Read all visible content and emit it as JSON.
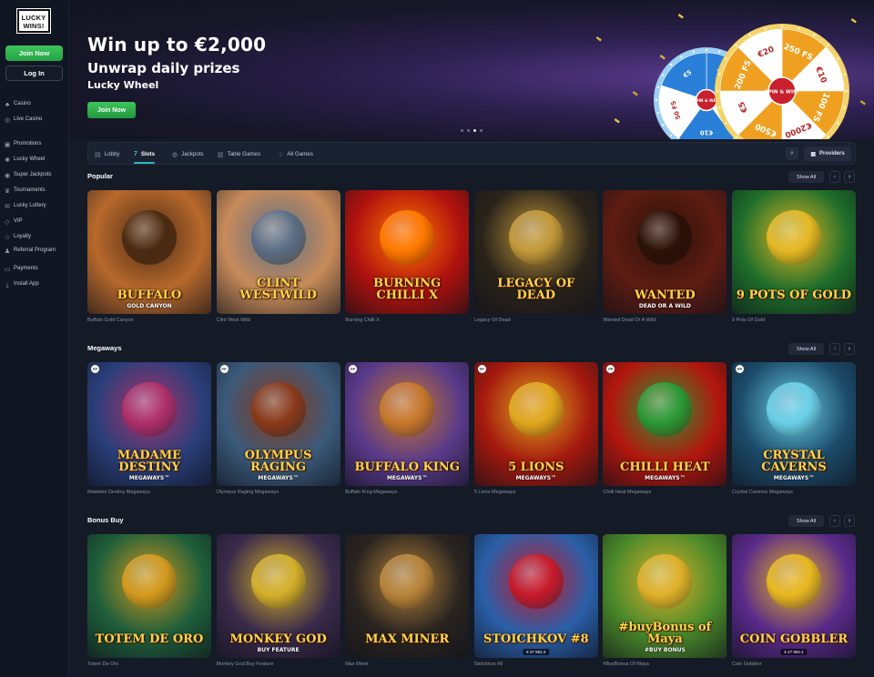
{
  "brand": {
    "logo_text": "LUCKY WINS!"
  },
  "sidebar": {
    "join_label": "Join Now",
    "login_label": "Log In",
    "items": [
      {
        "label": "Casino",
        "icon": "cards-icon"
      },
      {
        "label": "Live Casino",
        "icon": "live-icon"
      },
      {
        "label": "Promotions",
        "icon": "gift-icon"
      },
      {
        "label": "Lucky Wheel",
        "icon": "wheel-icon"
      },
      {
        "label": "Super Jackpots",
        "icon": "jackpot-icon"
      },
      {
        "label": "Tournaments",
        "icon": "trophy-icon"
      },
      {
        "label": "Lucky Lottery",
        "icon": "ticket-icon"
      },
      {
        "label": "VIP",
        "icon": "diamond-icon"
      },
      {
        "label": "Loyalty",
        "icon": "loyalty-icon"
      },
      {
        "label": "Referral Program",
        "icon": "referral-icon"
      },
      {
        "label": "Payments",
        "icon": "card-icon"
      },
      {
        "label": "Install App",
        "icon": "download-icon"
      }
    ]
  },
  "hero": {
    "title": "Win up to €2,000",
    "subtitle": "Unwrap daily prizes",
    "tagline": "Lucky Wheel",
    "cta": "Join Now",
    "wheel_big": {
      "labels": [
        "250 FS",
        "€10",
        "100 FS",
        "€2000",
        "€500",
        "€5",
        "200 FS",
        "€20"
      ],
      "center": "SPIN & WIN!"
    },
    "wheel_small": {
      "labels": [
        "25 FS",
        "€1000",
        "€10",
        "50 FS",
        "€5"
      ],
      "center": "SPIN & WIN!"
    },
    "slide_count": 4,
    "active_slide": 2
  },
  "tabs": [
    {
      "label": "Lobby",
      "icon": "lobby-icon",
      "active": false
    },
    {
      "label": "Slots",
      "icon": "slots-icon",
      "active": true
    },
    {
      "label": "Jackpots",
      "icon": "jackpot-icon",
      "active": false
    },
    {
      "label": "Table Games",
      "icon": "table-icon",
      "active": false
    },
    {
      "label": "All Games",
      "icon": "all-games-icon",
      "active": false
    }
  ],
  "providers_label": "Providers",
  "show_all_label": "Show All",
  "sections": [
    {
      "title": "Popular",
      "games": [
        {
          "name": "Buffalo Gold Canyon",
          "art_title": "BUFFALO",
          "art_sub": "GOLD CANYON",
          "bg": "#b8692c",
          "accent": "#4b2a12"
        },
        {
          "name": "Clint West Wild",
          "art_title": "CLINT WESTWILD",
          "art_sub": "",
          "bg": "#c88b5a",
          "accent": "#5b6e86"
        },
        {
          "name": "Burning Chilli X",
          "art_title": "BURNING CHILLI X",
          "art_sub": "",
          "bg": "#b0120e",
          "accent": "#ff7a00"
        },
        {
          "name": "Legacy Of Dead",
          "art_title": "LEGACY OF DEAD",
          "art_sub": "",
          "bg": "#2a231a",
          "accent": "#c49a3a"
        },
        {
          "name": "Wanted Dead Or A Wild",
          "art_title": "WANTED",
          "art_sub": "DEAD OR A WILD",
          "bg": "#5e1c12",
          "accent": "#2a1208"
        },
        {
          "name": "9 Pots Of Gold",
          "art_title": "9 POTS OF GOLD",
          "art_sub": "",
          "bg": "#1f6e2a",
          "accent": "#e6b823"
        }
      ]
    },
    {
      "title": "Megaways",
      "games": [
        {
          "name": "Madame Destiny Megaways",
          "art_title": "MADAME DESTINY",
          "art_sub": "MEGAWAYS™",
          "bg": "#2a3f7a",
          "accent": "#b0306a"
        },
        {
          "name": "Olympus Raging Megaways",
          "art_title": "OLYMPUS RAGING",
          "art_sub": "MEGAWAYS™",
          "bg": "#3b5a7a",
          "accent": "#8b3a1a"
        },
        {
          "name": "Buffalo King Megaways",
          "art_title": "BUFFALO KING",
          "art_sub": "MEGAWAYS™",
          "bg": "#5a3a8a",
          "accent": "#c8782a"
        },
        {
          "name": "5 Lions Megaways",
          "art_title": "5 LIONS",
          "art_sub": "MEGAWAYS™",
          "bg": "#a5190e",
          "accent": "#e0a91e"
        },
        {
          "name": "Chilli Heat Megaways",
          "art_title": "CHILLI HEAT",
          "art_sub": "MEGAWAYS™",
          "bg": "#b3160e",
          "accent": "#2a9a36"
        },
        {
          "name": "Crystal Caverns Megaways",
          "art_title": "CRYSTAL CAVERNS",
          "art_sub": "MEGAWAYS™",
          "bg": "#1c4b6a",
          "accent": "#6ad0e8"
        }
      ]
    },
    {
      "title": "Bonus Buy",
      "games": [
        {
          "name": "Totem De Oro",
          "art_title": "TOTEM DE ORO",
          "art_sub": "",
          "bg": "#1f5f3a",
          "accent": "#d59a1e"
        },
        {
          "name": "Monkey God Buy Feature",
          "art_title": "MONKEY GOD",
          "art_sub": "BUY FEATURE",
          "bg": "#3a2a4a",
          "accent": "#d4b02a"
        },
        {
          "name": "Max Miner",
          "art_title": "MAX MINER",
          "art_sub": "",
          "bg": "#2a2420",
          "accent": "#b8843a"
        },
        {
          "name": "Stoichkov #8",
          "art_title": "STOICHKOV #8",
          "art_sub": "€ 47 952.4",
          "bg": "#2a5fa8",
          "accent": "#c81a2a"
        },
        {
          "name": "#BuyBonus Of Maya",
          "art_title": "#buyBonus of Maya",
          "art_sub": "#BUY BONUS",
          "bg": "#4a8a2a",
          "accent": "#e0b02a"
        },
        {
          "name": "Coin Gobbler",
          "art_title": "COIN GOBBLER",
          "art_sub": "€ 47 952.4",
          "bg": "#5a2a8a",
          "accent": "#e8b81e"
        }
      ]
    }
  ]
}
